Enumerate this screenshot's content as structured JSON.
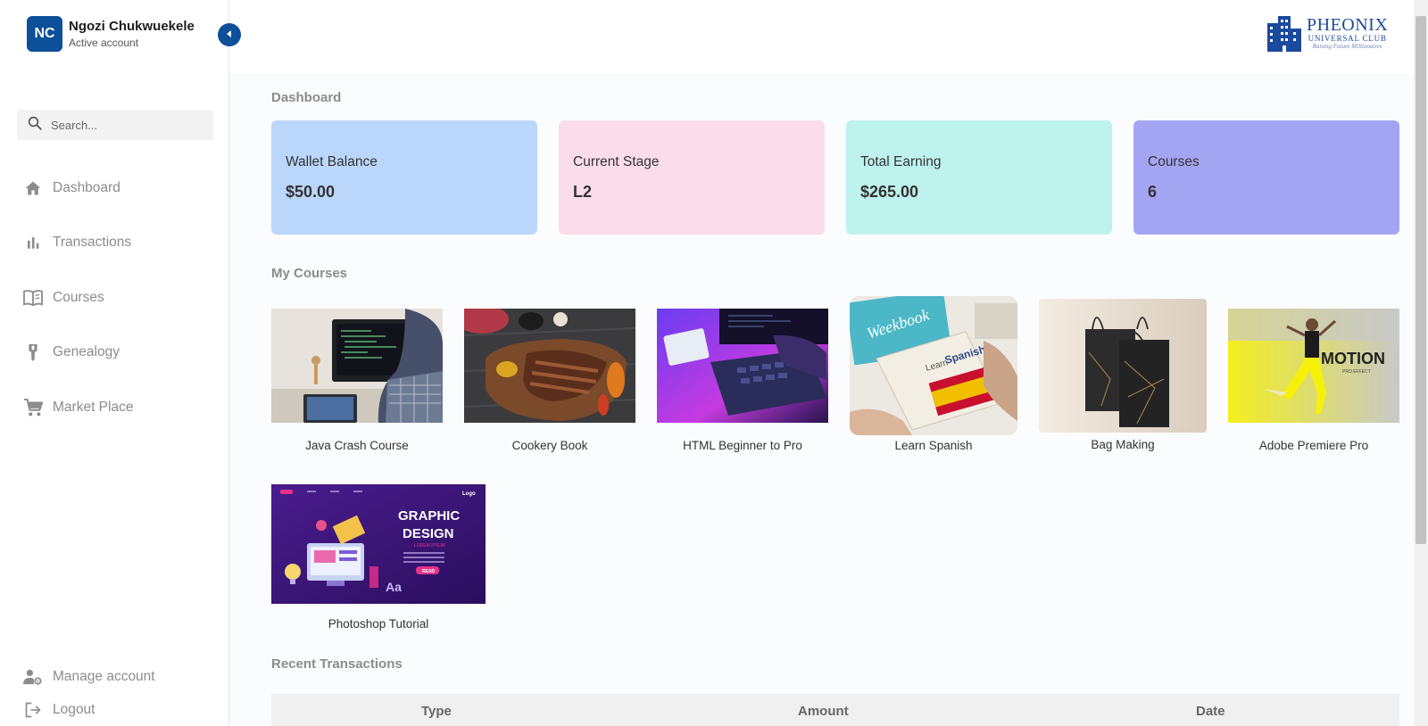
{
  "profile": {
    "initials": "NC",
    "name": "Ngozi Chukwuekele",
    "status": "Active account"
  },
  "search": {
    "placeholder": "Search..."
  },
  "nav": [
    {
      "label": "Dashboard",
      "icon": "home-icon"
    },
    {
      "label": "Transactions",
      "icon": "bar-chart-icon"
    },
    {
      "label": "Courses",
      "icon": "book-icon"
    },
    {
      "label": "Genealogy",
      "icon": "genealogy-icon"
    },
    {
      "label": "Market Place",
      "icon": "cart-icon"
    }
  ],
  "bottom_nav": [
    {
      "label": "Manage account",
      "icon": "manage-account-icon"
    },
    {
      "label": "Logout",
      "icon": "logout-icon"
    }
  ],
  "logo": {
    "title": "PHEONIX",
    "subtitle": "UNIVERSAL CLUB",
    "tagline": "Raising Future Millionaires"
  },
  "dashboard": {
    "title": "Dashboard",
    "cards": [
      {
        "label": "Wallet Balance",
        "value": "$50.00",
        "color": "#bbd6fb"
      },
      {
        "label": "Current Stage",
        "value": "L2",
        "color": "#fadcea"
      },
      {
        "label": "Total Earning",
        "value": "$265.00",
        "color": "#bef2ed"
      },
      {
        "label": "Courses",
        "value": "6",
        "color": "#a3a5f2"
      }
    ]
  },
  "my_courses": {
    "title": "My Courses",
    "items": [
      {
        "title": "Java Crash Course"
      },
      {
        "title": "Cookery Book"
      },
      {
        "title": "HTML Beginner to Pro"
      },
      {
        "title": "Learn Spanish"
      },
      {
        "title": "Bag Making"
      },
      {
        "title": "Adobe Premiere Pro"
      },
      {
        "title": "Photoshop Tutorial"
      }
    ],
    "image_text": {
      "spanish_small": "Learn",
      "spanish_big": "Spanish",
      "motion": "MOTION",
      "motion_sub": "PRO EFFECT",
      "gd_line1": "GRAPHIC",
      "gd_line2": "DESIGN",
      "gd_sub": "LOREM IPSUM",
      "gd_btn": "READ",
      "gd_logo": "Logo"
    }
  },
  "recent_transactions": {
    "title": "Recent Transactions",
    "columns": [
      "Type",
      "Amount",
      "Date"
    ]
  },
  "colors": {
    "brand": "#0d4f99",
    "nav_text": "#8c8c8c"
  }
}
